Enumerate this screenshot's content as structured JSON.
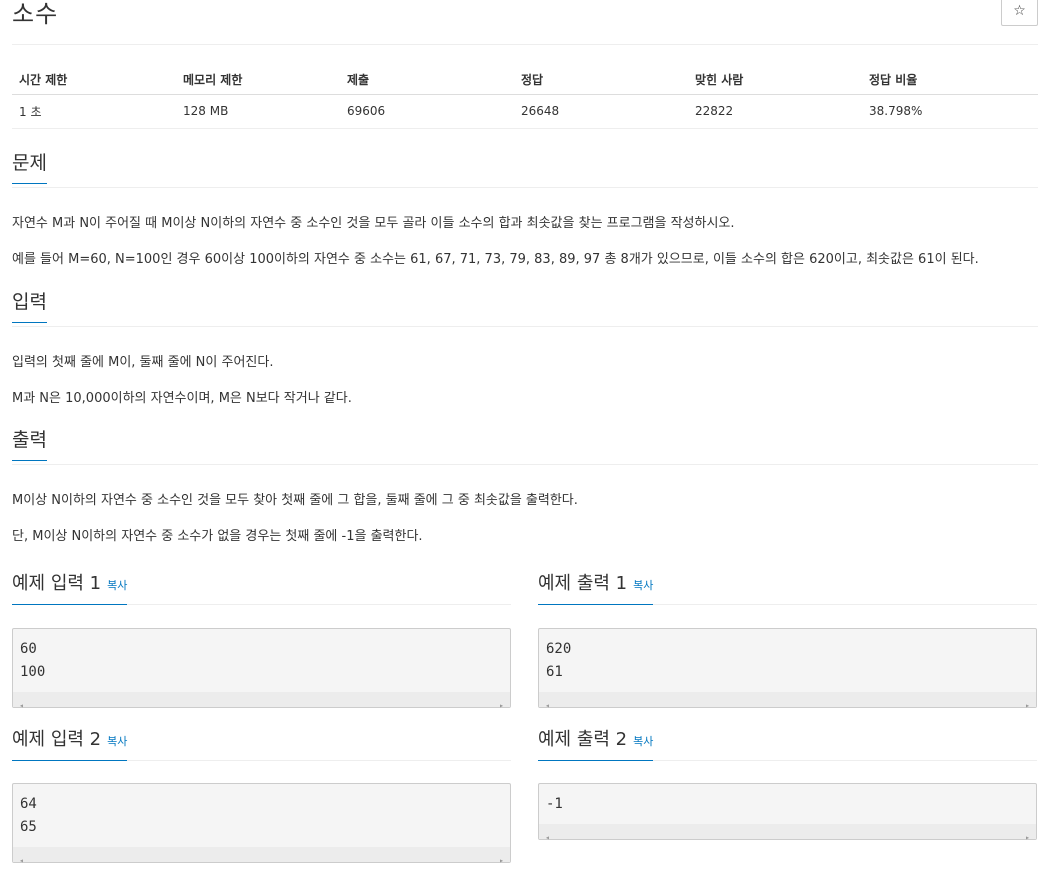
{
  "problem": {
    "title": "소수",
    "star_icon": "☆"
  },
  "stats": {
    "headers": [
      "시간 제한",
      "메모리 제한",
      "제출",
      "정답",
      "맞힌 사람",
      "정답 비율"
    ],
    "values": [
      "1 초",
      "128 MB",
      "69606",
      "26648",
      "22822",
      "38.798%"
    ]
  },
  "description": {
    "heading": "문제",
    "paragraphs": [
      "자연수 M과 N이 주어질 때 M이상 N이하의 자연수 중 소수인 것을 모두 골라 이들 소수의 합과 최솟값을 찾는 프로그램을 작성하시오.",
      "예를 들어 M=60, N=100인 경우 60이상 100이하의 자연수 중 소수는 61, 67, 71, 73, 79, 83, 89, 97 총 8개가 있으므로, 이들 소수의 합은 620이고, 최솟값은 61이 된다."
    ]
  },
  "input": {
    "heading": "입력",
    "paragraphs": [
      "입력의 첫째 줄에 M이, 둘째 줄에 N이 주어진다.",
      "M과 N은 10,000이하의 자연수이며, M은 N보다 작거나 같다."
    ]
  },
  "output": {
    "heading": "출력",
    "paragraphs": [
      "M이상 N이하의 자연수 중 소수인 것을 모두 찾아 첫째 줄에 그 합을, 둘째 줄에 그 중 최솟값을 출력한다.",
      "단, M이상 N이하의 자연수 중 소수가 없을 경우는 첫째 줄에 -1을 출력한다."
    ]
  },
  "samples": {
    "copy_label": "복사",
    "input1": {
      "title": "예제 입력 1",
      "lines": [
        "60",
        "100"
      ]
    },
    "output1": {
      "title": "예제 출력 1",
      "lines": [
        "620",
        "61"
      ]
    },
    "input2": {
      "title": "예제 입력 2",
      "lines": [
        "64",
        "65"
      ]
    },
    "output2": {
      "title": "예제 출력 2",
      "lines": [
        "-1"
      ]
    }
  },
  "scroll_arrows": {
    "left": "◂",
    "right": "▸"
  }
}
